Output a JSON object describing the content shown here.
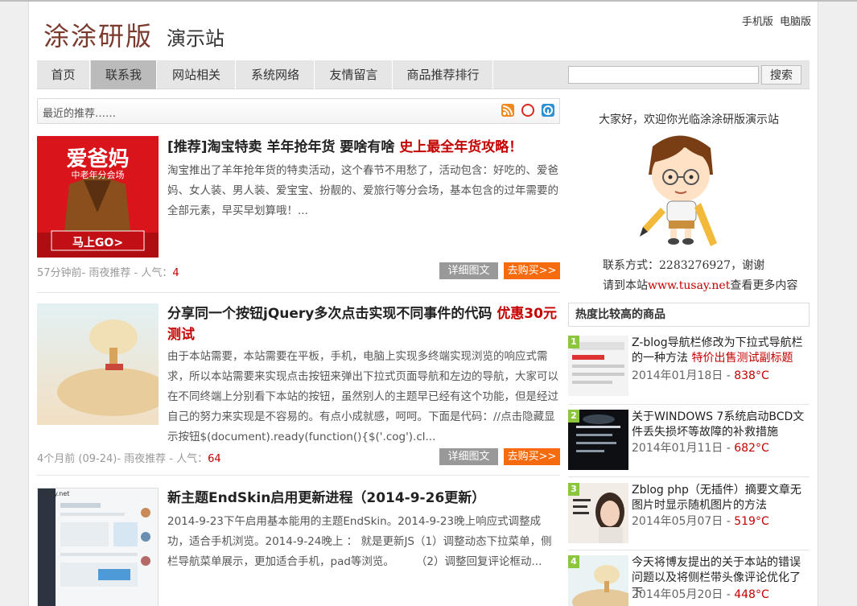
{
  "site": {
    "logo_title": "涂涂研版",
    "logo_subtitle": "演示站",
    "view_mobile": "手机版",
    "view_desktop": "电脑版"
  },
  "nav": {
    "items": [
      {
        "label": "首页",
        "active": false
      },
      {
        "label": "联系我",
        "active": true
      },
      {
        "label": "网站相关",
        "active": false
      },
      {
        "label": "系统网络",
        "active": false
      },
      {
        "label": "友情留言",
        "active": false
      },
      {
        "label": "商品推荐排行",
        "active": false
      }
    ],
    "search_value": "",
    "search_button": "搜索"
  },
  "recent": {
    "label": "最近的推荐……",
    "icons": [
      "rss-icon",
      "weibo-icon",
      "qzone-icon"
    ]
  },
  "posts": [
    {
      "title": "[推荐]淘宝特卖 羊年抢年货 要啥有啥",
      "highlight": "史上最全年货攻略！",
      "excerpt": "淘宝推出了羊年抢年货的特卖活动，这个春节不用愁了，活动包含：好吃的、爱爸妈、女人装、男人装、爱宝宝、扮靓的、爱旅行等分会场，基本包含的过年需要的全部元素，早买早划算哦！...",
      "meta_time": "57分钟前- 雨夜推荐 - 人气：",
      "views": "4",
      "thumb_text_main": "爱爸妈",
      "thumb_text_sub": "中老年分会场",
      "thumb_text_go": "马上GO>",
      "detail_label": "详细图文",
      "buy_label": "去购买>>"
    },
    {
      "title": "分享同一个按钮jQuery多次点击实现不同事件的代码",
      "highlight": "优惠30元测试",
      "excerpt": "由于本站需要，本站需要在平板，手机，电脑上实现多终端实现浏览的响应式需求，所以本站需要来实现点击按钮来弹出下拉式页面导航和左边的导航，大家可以在不同终端上分别看下本站的按钮，虽然别人的主题早已经有这个功能，但是经过自己的努力来实现是不容易的。有点小成就感，呵呵。下面是代码：//点击隐藏显示按钮$(document).ready(function(){$('.cog').cl...",
      "meta_time": "4个月前 (09-24)- 雨夜推荐 - 人气：",
      "views": "64",
      "detail_label": "详细图文",
      "buy_label": "去购买>>"
    },
    {
      "title": "新主题EndSkin启用更新进程（2014-9-26更新）",
      "highlight": "",
      "excerpt": "2014-9-23下午启用基本能用的主题EndSkin。2014-9-23晚上响应式调整成功，适合手机浏览。2014-9-24晚上 ： 就是更新JS（1）调整动态下拉菜单，侧栏导航菜单展示，更加适合手机，pad等浏览。　　　（2）调整回复评论框动...",
      "thumb_text_main": "Tulley.net"
    }
  ],
  "sidebar": {
    "welcome": "大家好，欢迎你光临涂涂研版演示站",
    "contact_line": "联系方式：2283276927，谢谢",
    "visit_prefix": "请到本站",
    "visit_link": "www.tusay.net",
    "visit_suffix": "查看更多内容",
    "hot_heading": "热度比较高的商品",
    "hot_items": [
      {
        "rank": "1",
        "title": "Z-blog导航栏修改为下拉式导航栏的一种方法",
        "highlight": "特价出售测试副标题",
        "date": "2014年01月18日 - ",
        "views": "838°C"
      },
      {
        "rank": "2",
        "title": "关于WINDOWS 7系统启动BCD文件丢失损坏等故障的补救措施",
        "highlight": "",
        "date": "2014年01月11日 - ",
        "views": "682°C"
      },
      {
        "rank": "3",
        "title": "Zblog php（无插件）摘要文章无图片时显示随机图片的方法",
        "highlight": "",
        "date": "2014年05月07日 - ",
        "views": "519°C"
      },
      {
        "rank": "4",
        "title": "今天将博友提出的关于本站的错误问题以及将侧栏带头像评论优化了下",
        "highlight": "",
        "date": "2014年05月20日 - ",
        "views": "448°C"
      }
    ]
  }
}
